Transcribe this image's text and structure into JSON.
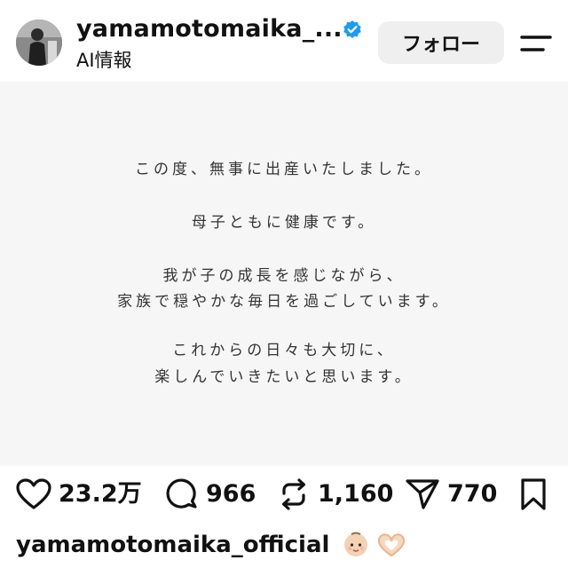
{
  "header": {
    "username": "yamamotomaika_...",
    "subtitle": "AI情報",
    "follow_label": "フォロー",
    "verified_icon": "verified-badge-icon",
    "menu_icon": "menu-icon"
  },
  "post": {
    "lines": [
      "この度、無事に出産いたしました。",
      "母子ともに健康です。",
      "我が子の成長を感じながら、",
      "家族で穏やかな毎日を過ごしています。",
      "これからの日々も大切に、",
      "楽しんでいきたいと思います。"
    ]
  },
  "actions": {
    "likes": "23.2万",
    "comments": "966",
    "reposts": "1,160",
    "shares": "770"
  },
  "caption": {
    "username": "yamamotomaika_official",
    "emojis": [
      "baby-emoji",
      "heart-hands-emoji"
    ]
  },
  "colors": {
    "verified": "#1d9bf0",
    "follow_bg": "#efefef",
    "image_bg": "#f6f6f6"
  }
}
